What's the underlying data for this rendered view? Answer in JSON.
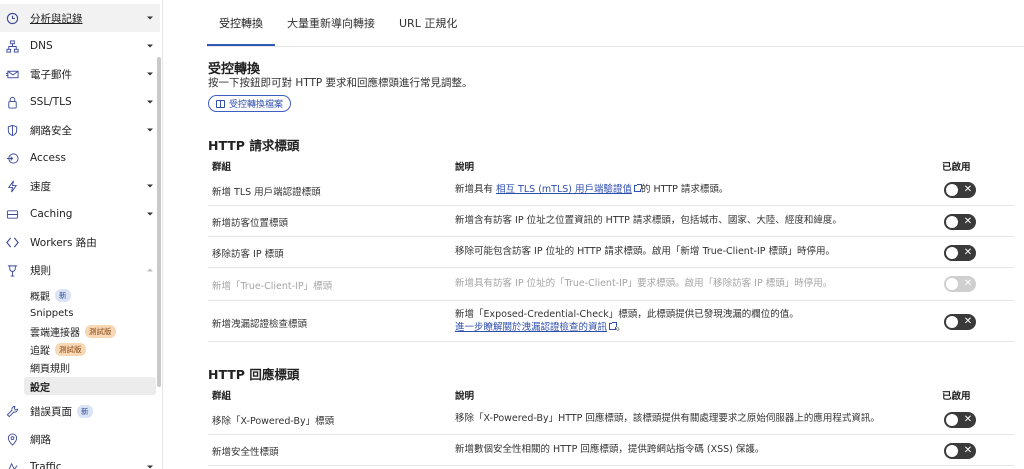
{
  "sidebar": {
    "items": [
      {
        "label": "分析與記錄",
        "icon": "clock-icon"
      },
      {
        "label": "DNS",
        "icon": "network-icon"
      },
      {
        "label": "電子郵件",
        "icon": "email-icon"
      },
      {
        "label": "SSL/TLS",
        "icon": "lock-icon"
      },
      {
        "label": "網路安全",
        "icon": "shield-icon"
      },
      {
        "label": "Access",
        "icon": "access-icon"
      },
      {
        "label": "速度",
        "icon": "lightning-icon"
      },
      {
        "label": "Caching",
        "icon": "server-icon"
      },
      {
        "label": "Workers 路由",
        "icon": "workers-icon"
      },
      {
        "label": "規則",
        "icon": "rules-icon"
      },
      {
        "label": "錯誤頁面",
        "icon": "wrench-icon",
        "badge": "新"
      },
      {
        "label": "網路",
        "icon": "location-icon"
      },
      {
        "label": "Traffic",
        "icon": "traffic-icon"
      }
    ],
    "sub_items": [
      {
        "label": "概觀",
        "badge": "新"
      },
      {
        "label": "Snippets"
      },
      {
        "label": "雲端連接器",
        "badge": "測試版"
      },
      {
        "label": "追蹤",
        "badge": "測試版"
      },
      {
        "label": "網頁規則"
      },
      {
        "label": "設定"
      }
    ]
  },
  "tabs": [
    {
      "label": "受控轉換"
    },
    {
      "label": "大量重新導向轉接"
    },
    {
      "label": "URL 正規化"
    }
  ],
  "header": {
    "title": "受控轉換",
    "description": "按一下按鈕即可對 HTTP 要求和回應標頭進行常見調整。",
    "button_label": "受控轉換檔案"
  },
  "request_section": {
    "title": "HTTP 請求標頭",
    "columns": {
      "group": "群組",
      "description": "說明",
      "enabled": "已啟用"
    },
    "rows": [
      {
        "group": "新增 TLS 用戶端認證標頭",
        "desc_before": "新增具有 ",
        "desc_link": "相互 TLS (mTLS) 用戶端驗證值",
        "desc_after": "的 HTTP 請求標頭。",
        "enabled": false,
        "disabled": false
      },
      {
        "group": "新增訪客位置標頭",
        "desc": "新增含有訪客 IP 位址之位置資訊的 HTTP 請求標頭，包括城市、國家、大陸、經度和緯度。",
        "enabled": false,
        "disabled": false
      },
      {
        "group": "移除訪客 IP 標頭",
        "desc": "移除可能包含訪客 IP 位址的 HTTP 請求標頭。啟用「新增 True-Client-IP 標頭」時停用。",
        "enabled": false,
        "disabled": false
      },
      {
        "group": "新增「True-Client-IP」標頭",
        "desc": "新增具有訪客 IP 位址的「True-Client-IP」要求標頭。啟用「移除訪客 IP 標頭」時停用。",
        "enabled": false,
        "disabled": true
      },
      {
        "group": "新增洩漏認證檢查標頭",
        "desc_line1": "新增「Exposed-Credential-Check」標頭，此標頭提供已發現洩漏的欄位的值。",
        "desc_link": "進一步瞭解關於洩漏認證檢查的資訊",
        "desc_after": "。",
        "enabled": false,
        "disabled": false
      }
    ]
  },
  "response_section": {
    "title": "HTTP 回應標頭",
    "columns": {
      "group": "群組",
      "description": "說明",
      "enabled": "已啟用"
    },
    "rows": [
      {
        "group": "移除「X-Powered-By」標頭",
        "desc": "移除「X-Powered-By」HTTP 回應標頭，該標頭提供有關處理要求之原始伺服器上的應用程式資訊。",
        "enabled": false
      },
      {
        "group": "新增安全性標頭",
        "desc": "新增數個安全性相關的 HTTP 回應標頭，提供跨網站指令碼 (XSS) 保護。",
        "enabled": false
      }
    ]
  },
  "toggle_off_glyph": "✕"
}
